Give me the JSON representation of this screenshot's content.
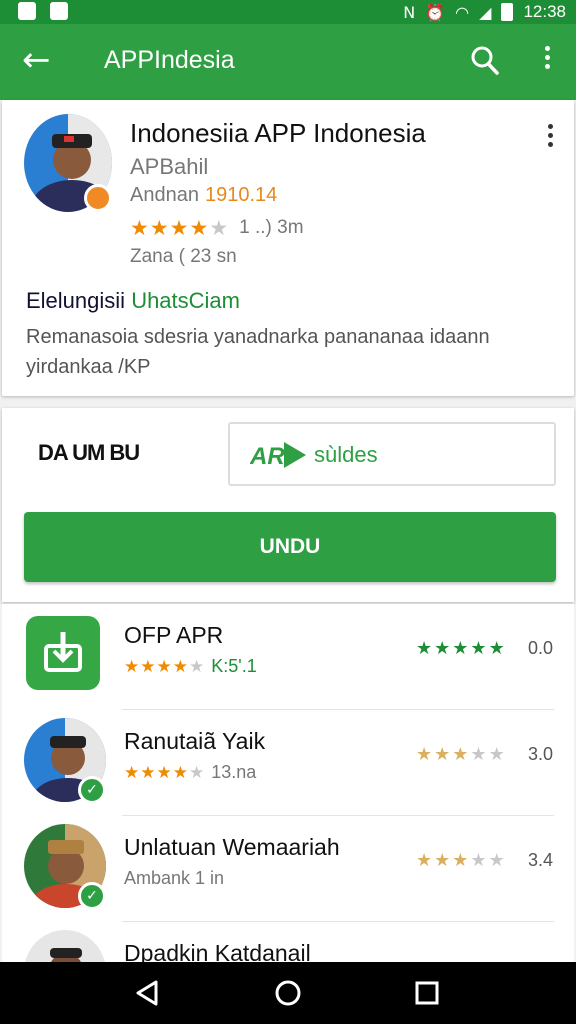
{
  "status_bar": {
    "time": "12:38",
    "icons": [
      "nfc-icon",
      "alarm-icon",
      "wifi-icon",
      "signal-icon",
      "battery-icon"
    ]
  },
  "app_bar": {
    "title": "APPIndesia",
    "back_icon": "arrow-left-icon",
    "search_icon": "search-icon",
    "more_icon": "more-vert-icon"
  },
  "app_card": {
    "title": "Indonesiia APP Indonesia",
    "developer": "APBahil",
    "meta_prefix": "Andnan",
    "meta_highlight": "1910.14",
    "rating_stars": 4,
    "rating_count": "1 ..) 3m",
    "size_text": "Zana ( 23 sn",
    "feature_title_dark": "Elelungisii",
    "feature_title_green": "UhatsCiam",
    "description": "Remanasoia sdesria yanadnarka panananaa idaann yirdankaa /KP"
  },
  "actions": {
    "downloads_label": "DA UM BU",
    "rating_box_text": "sùldes",
    "rating_box_logo": "AR",
    "install_label": "UNDU"
  },
  "related": [
    {
      "title": "OFP APR",
      "sub_text": "K:5'.1",
      "sub_stars": 4,
      "right_stars": 5,
      "right_value": "0.0",
      "icon": "download-app-icon"
    },
    {
      "title": "Ranutaiã Yaik",
      "sub_text": "13.na",
      "sub_stars": 4,
      "right_stars": 3,
      "right_value": "3.0",
      "icon": "avatar-icon"
    },
    {
      "title": "Unlatuan Wemaariah",
      "sub_text": "Ambank 1 in",
      "sub_stars": 0,
      "right_stars": 3,
      "right_value": "3.4",
      "icon": "avatar-icon"
    },
    {
      "title": "Dpadkin Katdanail",
      "sub_text": "",
      "sub_stars": 0,
      "right_stars": 0,
      "right_value": "",
      "icon": "avatar-icon"
    }
  ],
  "nav_bar": {
    "icons": [
      "back-triangle-icon",
      "home-circle-icon",
      "recents-square-icon"
    ]
  },
  "colors": {
    "primary": "#2ea043",
    "status_bar": "#1e8e36",
    "star": "#f08a00"
  }
}
